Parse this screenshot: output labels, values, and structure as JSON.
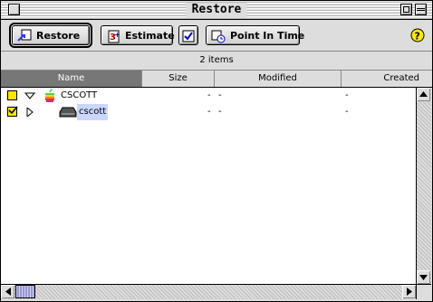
{
  "window": {
    "title": "Restore"
  },
  "toolbar": {
    "restore_label": "Restore",
    "estimate_label": "Estimate",
    "point_in_time_label": "Point In Time"
  },
  "info": {
    "item_count": "2 items"
  },
  "columns": {
    "name": "Name",
    "size": "Size",
    "modified": "Modified",
    "created": "Created"
  },
  "rows": [
    {
      "name": "CSCOTT",
      "size": "-",
      "modified": "-",
      "created": "-",
      "checkbox": "partial",
      "expanded": true
    },
    {
      "name": "cscott",
      "size": "-",
      "modified": "-",
      "created": "-",
      "checkbox": "checked",
      "expanded": false
    }
  ],
  "colors": {
    "checkbox": "#ffe800",
    "selection": "#cbd6ff",
    "sorted_header": "#777777"
  }
}
